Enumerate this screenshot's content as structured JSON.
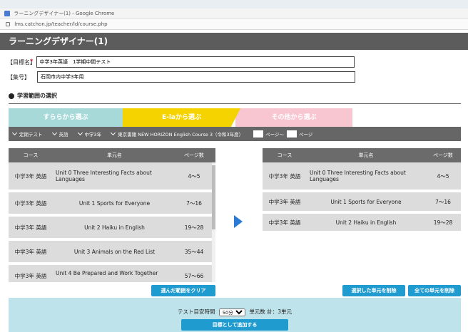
{
  "browser": {
    "title": "ラーニングデザイナー(1) - Google Chrome",
    "url": "lms.catchon.jp/teacher/ld/course.php"
  },
  "app": {
    "title": "ラーニングデザイナー(1)"
  },
  "form": {
    "goal_label": "【目標名】",
    "goal_required": "*",
    "goal_value": "中学3年英語　1学期中間テスト",
    "class_label": "【集号】",
    "class_value": "石岡市内中学3年用"
  },
  "section": {
    "title": "学習範囲の選択"
  },
  "tabs": [
    {
      "label": "すららから選ぶ"
    },
    {
      "label": "E-laから選ぶ"
    },
    {
      "label": "その他から選ぶ"
    }
  ],
  "filters": {
    "f1": "定期テスト",
    "f2": "英語",
    "f3": "中学3年",
    "f4": "東京書籍 NEW HORIZON English Course 3（令和3年度）",
    "page_from": "ページ～",
    "page_to": "ページ"
  },
  "left_table": {
    "headers": [
      "コース",
      "単元名",
      "ページ数"
    ],
    "rows": [
      {
        "course": "中学3年 英語",
        "unit": "Unit 0 Three Interesting Facts about Languages",
        "pages": "4～5"
      },
      {
        "course": "中学3年 英語",
        "unit": "Unit 1 Sports for Everyone",
        "pages": "7～16"
      },
      {
        "course": "中学3年 英語",
        "unit": "Unit 2 Haiku in English",
        "pages": "19～28"
      },
      {
        "course": "中学3年 英語",
        "unit": "Unit 3 Animals on the Red List",
        "pages": "35～44"
      },
      {
        "course": "中学3年 英語",
        "unit": "Unit 4 Be Prepared and Work Together",
        "pages": "57～66"
      }
    ]
  },
  "right_table": {
    "headers": [
      "コース",
      "単元名",
      "ページ数"
    ],
    "rows": [
      {
        "course": "中学3年 英語",
        "unit": "Unit 0 Three Interesting Facts about Languages",
        "pages": "4～5"
      },
      {
        "course": "中学3年 英語",
        "unit": "Unit 1 Sports for Everyone",
        "pages": "7～16"
      },
      {
        "course": "中学3年 英語",
        "unit": "Unit 2 Haiku in English",
        "pages": "19～28"
      }
    ]
  },
  "buttons": {
    "clear": "選んだ範囲をクリア",
    "delete_selected": "選択した単元を削除",
    "delete_all": "全ての単元を削除"
  },
  "bottom": {
    "time_label": "テスト目安時間",
    "time_value": "50分",
    "summary": "単元数 計：3単元",
    "submit": "目標として追加する"
  },
  "colors": {
    "accent": "#1f9bd0",
    "arrow": "#2a7ad8",
    "tab_yellow": "#f4d300"
  }
}
